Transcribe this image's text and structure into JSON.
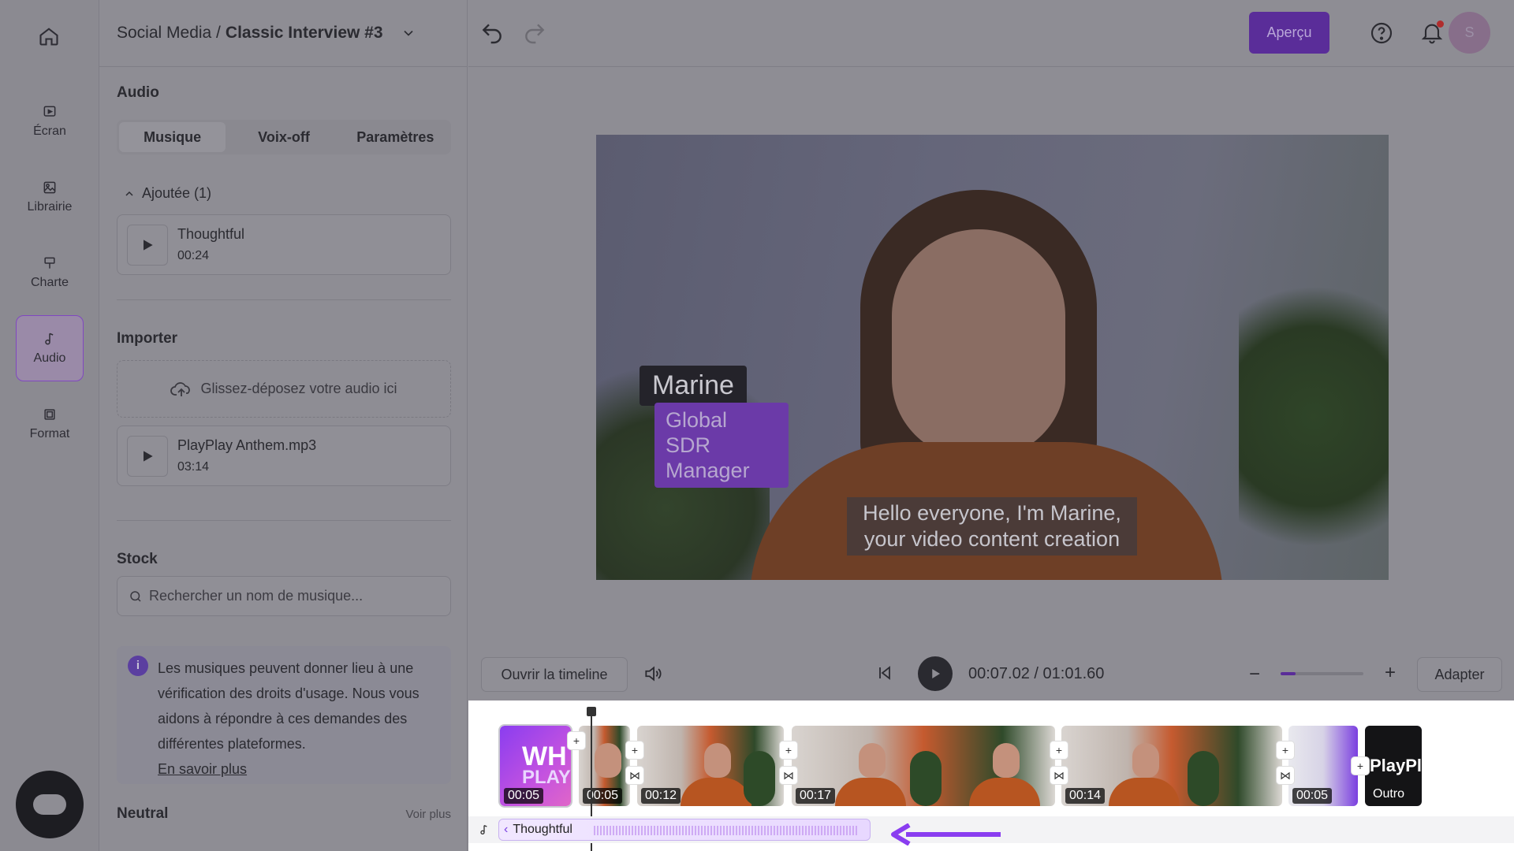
{
  "header": {
    "breadcrumb_parent": "Social Media /",
    "project_name": "Classic Interview #3",
    "preview_label": "Aperçu",
    "avatar_initial": "S"
  },
  "rail": {
    "items": [
      {
        "label": "Écran",
        "icon": "screen-icon"
      },
      {
        "label": "Librairie",
        "icon": "library-icon"
      },
      {
        "label": "Charte",
        "icon": "brush-icon"
      },
      {
        "label": "Audio",
        "icon": "music-note-icon",
        "active": true
      },
      {
        "label": "Format",
        "icon": "format-icon"
      }
    ]
  },
  "panel": {
    "title": "Audio",
    "tabs": [
      "Musique",
      "Voix-off",
      "Paramètres"
    ],
    "added_label": "Ajoutée (1)",
    "added_tracks": [
      {
        "name": "Thoughtful",
        "duration": "00:24"
      }
    ],
    "import_title": "Importer",
    "dropzone_text": "Glissez-déposez votre audio ici",
    "imported_tracks": [
      {
        "name": "PlayPlay Anthem.mp3",
        "duration": "03:14"
      }
    ],
    "stock_title": "Stock",
    "search_placeholder": "Rechercher un nom de musique...",
    "info_text": "Les musiques peuvent donner lieu à une vérification des droits d'usage. Nous vous aidons à répondre à ces demandes des différentes plateformes.",
    "info_link": "En savoir plus",
    "neutral_title": "Neutral",
    "see_more": "Voir plus"
  },
  "preview": {
    "name_tag": "Marine",
    "role_tag": "Global SDR Manager",
    "subtitle": "Hello everyone, I'm Marine, your video content creation"
  },
  "controls": {
    "open_timeline": "Ouvrir la timeline",
    "time": "00:07.02 / 01:01.60",
    "zoom_level": 0.18,
    "fit_label": "Adapter"
  },
  "timeline": {
    "clips": [
      {
        "type": "intro",
        "duration": "00:05",
        "text": "WH",
        "subtext": "PLAY"
      },
      {
        "type": "scene",
        "duration": "00:05"
      },
      {
        "type": "scene",
        "duration": "00:12"
      },
      {
        "type": "scene",
        "duration": "00:17"
      },
      {
        "type": "scene",
        "duration": "00:14"
      },
      {
        "type": "scene",
        "duration": "00:05"
      },
      {
        "type": "outro",
        "duration": "Outro",
        "text": "PlayPl"
      }
    ],
    "audio_track": "Thoughtful",
    "accent": "#8a3df0"
  }
}
